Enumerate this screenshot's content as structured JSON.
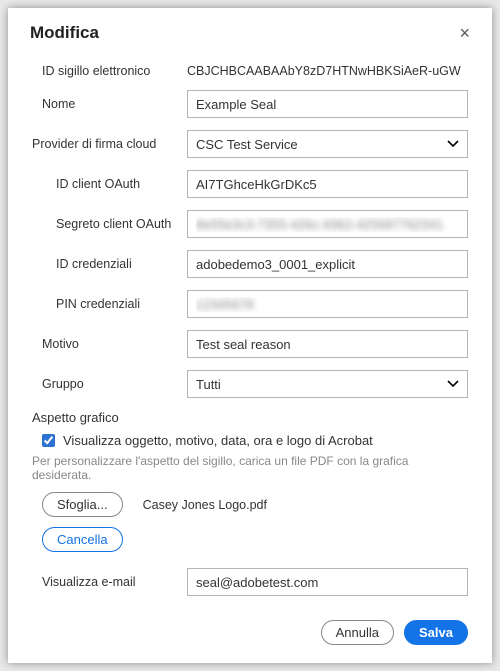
{
  "dialog": {
    "title": "Modifica",
    "close_label": "×"
  },
  "fields": {
    "seal_id_label": "ID sigillo elettronico",
    "seal_id_value": "CBJCHBCAABAAbY8zD7HTNwHBKSiAeR-uGW",
    "name_label": "Nome",
    "name_value": "Example Seal",
    "provider_label": "Provider di firma cloud",
    "provider_value": "CSC Test Service",
    "oauth_id_label": "ID client OAuth",
    "oauth_id_value": "AI7TGhceHkGrDKc5",
    "oauth_secret_label": "Segreto client OAuth",
    "oauth_secret_value": "8e55e3c3-7355-426c-9362-425697762341",
    "cred_id_label": "ID credenziali",
    "cred_id_value": "adobedemo3_0001_explicit",
    "cred_pin_label": "PIN credenziali",
    "cred_pin_value": "12345678",
    "reason_label": "Motivo",
    "reason_value": "Test seal reason",
    "group_label": "Gruppo",
    "group_value": "Tutti"
  },
  "appearance": {
    "section_title": "Aspetto grafico",
    "checkbox_label": "Visualizza oggetto, motivo, data, ora e logo di Acrobat",
    "help_text": "Per personalizzare l'aspetto del sigillo, carica un file PDF con la grafica desiderata.",
    "browse_label": "Sfoglia...",
    "uploaded_file": "Casey Jones Logo.pdf",
    "clear_label": "Cancella",
    "email_label": "Visualizza e-mail",
    "email_value": "seal@adobetest.com"
  },
  "footer": {
    "cancel": "Annulla",
    "save": "Salva"
  }
}
